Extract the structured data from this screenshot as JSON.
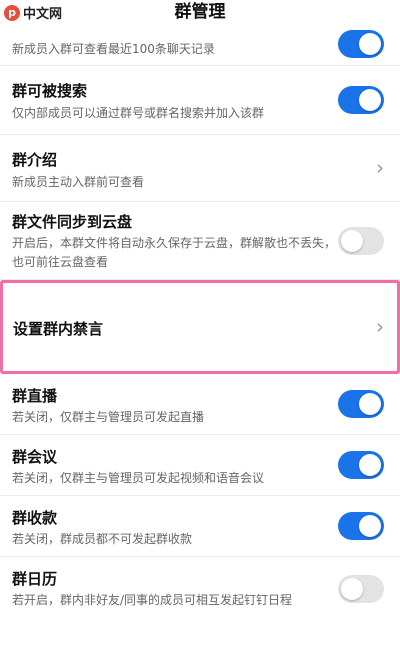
{
  "header": {
    "title": "群管理"
  },
  "watermark": {
    "logo": "php",
    "text": "中文网"
  },
  "rows": [
    {
      "id": "history",
      "subtitle": "新成员入群可查看最近100条聊天记录",
      "control": "toggle",
      "on": true
    },
    {
      "id": "searchable",
      "title": "群可被搜索",
      "subtitle": "仅内部成员可以通过群号或群名搜索并加入该群",
      "control": "toggle",
      "on": true
    },
    {
      "id": "intro",
      "title": "群介绍",
      "subtitle": "新成员主动入群前可查看",
      "control": "chevron"
    },
    {
      "id": "cloud",
      "title": "群文件同步到云盘",
      "subtitle": "开启后，本群文件将自动永久保存于云盘，群解散也不丢失，也可前往云盘查看",
      "control": "toggle",
      "on": false
    },
    {
      "id": "mute",
      "title": "设置群内禁言",
      "control": "chevron"
    },
    {
      "id": "live",
      "title": "群直播",
      "subtitle": "若关闭，仅群主与管理员可发起直播",
      "control": "toggle",
      "on": true
    },
    {
      "id": "meeting",
      "title": "群会议",
      "subtitle": "若关闭，仅群主与管理员可发起视频和语音会议",
      "control": "toggle",
      "on": true
    },
    {
      "id": "payment",
      "title": "群收款",
      "subtitle": "若关闭，群成员都不可发起群收款",
      "control": "toggle",
      "on": true
    },
    {
      "id": "calendar",
      "title": "群日历",
      "subtitle": "若开启，群内非好友/同事的成员可相互发起钉钉日程",
      "control": "toggle",
      "on": false
    }
  ],
  "icons": {
    "chevron": "chevron-right-icon",
    "toggle": "toggle-switch"
  },
  "colors": {
    "accent": "#1a73e8",
    "highlight": "#f06ea5",
    "toggle_off": "#e3e3e3"
  }
}
